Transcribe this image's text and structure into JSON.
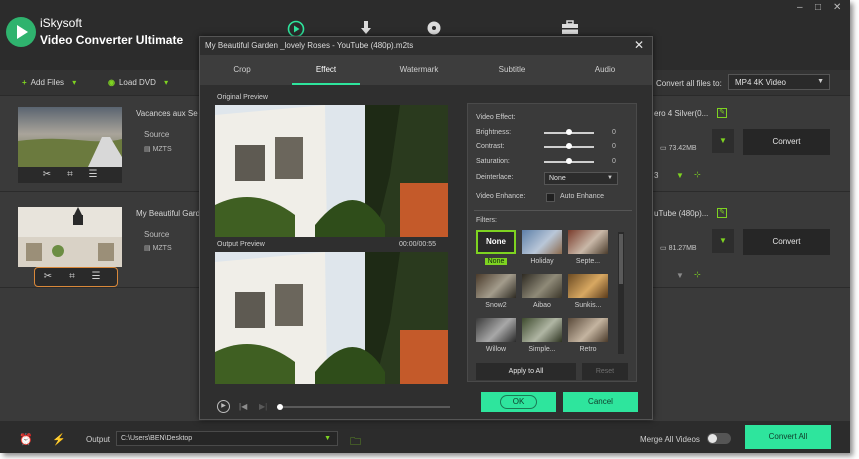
{
  "app": {
    "brand": "iSkysoft",
    "product": "Video Converter Ultimate",
    "window_controls": [
      "–",
      "□",
      "✕"
    ]
  },
  "toolbar": {
    "add_files": "Add Files",
    "load_dvd": "Load DVD",
    "convert_all_to_label": "Convert all files to:",
    "convert_all_to_value": "MP4 4K Video"
  },
  "files": [
    {
      "title": "Vacances aux Se",
      "source_label": "Source",
      "format": "MZTS",
      "target_title": "ero 4 Silver(0...",
      "size": "73.42MB",
      "subtitle_value": "3",
      "convert_label": "Convert"
    },
    {
      "title": "My Beautiful Gard",
      "source_label": "Source",
      "format": "MZTS",
      "target_title": "uTube (480p)...",
      "size": "81.27MB",
      "convert_label": "Convert"
    }
  ],
  "modal": {
    "title": "My Beautiful Garden _lovely Roses - YouTube (480p).m2ts",
    "tabs": [
      "Crop",
      "Effect",
      "Watermark",
      "Subtitle",
      "Audio"
    ],
    "active_tab": "Effect",
    "original_preview_label": "Original Preview",
    "output_preview_label": "Output Preview",
    "time": "00:00/00:55",
    "video_effect_label": "Video Effect:",
    "brightness_label": "Brightness:",
    "brightness_value": "0",
    "contrast_label": "Contrast:",
    "contrast_value": "0",
    "saturation_label": "Saturation:",
    "saturation_value": "0",
    "deinterlace_label": "Deinterlace:",
    "deinterlace_value": "None",
    "video_enhance_label": "Video Enhance:",
    "auto_enhance_label": "Auto Enhance",
    "filters_label": "Filters:",
    "filters": [
      "None",
      "Holiday",
      "Septe...",
      "Snow2",
      "Aibao",
      "Sunkis...",
      "Willow",
      "Simple...",
      "Retro"
    ],
    "filter_none_swatch_text": "None",
    "selected_filter": "None",
    "apply_all_label": "Apply to All",
    "reset_label": "Reset",
    "ok_label": "OK",
    "cancel_label": "Cancel"
  },
  "bottom": {
    "output_label": "Output",
    "output_path": "C:\\Users\\BEN\\Desktop",
    "merge_label": "Merge All Videos",
    "convert_all_label": "Convert All"
  },
  "colors": {
    "accent_green": "#2ee59d",
    "icon_green": "#7ed321",
    "highlight_orange": "#d9883a"
  }
}
